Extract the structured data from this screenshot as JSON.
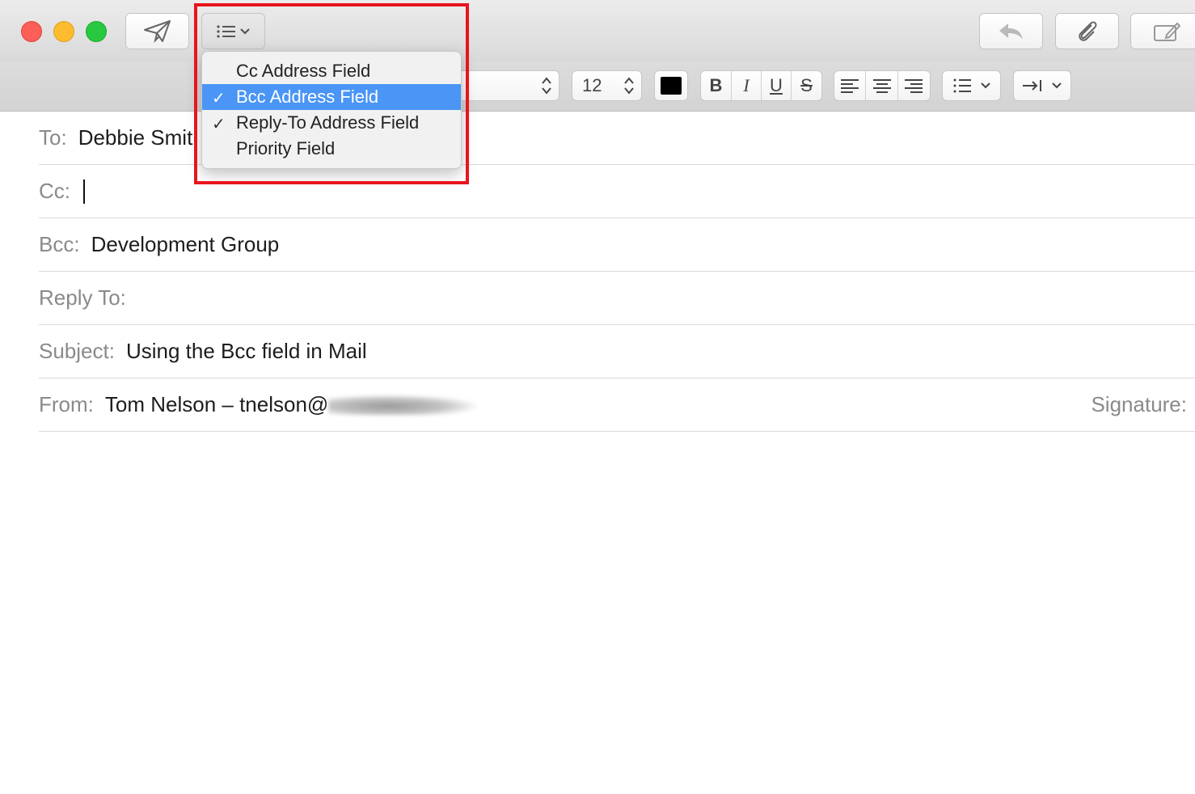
{
  "colors": {
    "accent": "#4a95f5",
    "annotation_border": "#e8141c",
    "text_color_swatch": "#000000"
  },
  "toolbar": {
    "send_icon": "paper-plane-icon",
    "header_fields_icon": "list-icon",
    "reply_icon": "reply-arrow-icon",
    "attach_icon": "paperclip-icon",
    "markup_icon": "compose-icon"
  },
  "format_bar": {
    "font_size": "12",
    "bold": "B",
    "italic": "I",
    "underline": "U",
    "strikethrough": "S"
  },
  "header_menu": {
    "items": [
      {
        "label": "Cc Address Field",
        "checked": false,
        "selected": false
      },
      {
        "label": "Bcc Address Field",
        "checked": true,
        "selected": true
      },
      {
        "label": "Reply-To Address Field",
        "checked": true,
        "selected": false
      },
      {
        "label": "Priority Field",
        "checked": false,
        "selected": false
      }
    ]
  },
  "fields": {
    "to_label": "To:",
    "to_value": "Debbie Smit",
    "cc_label": "Cc:",
    "bcc_label": "Bcc:",
    "bcc_value": "Development Group",
    "reply_to_label": "Reply To:",
    "subject_label": "Subject:",
    "subject_value": "Using the Bcc field in Mail",
    "from_label": "From:",
    "from_value": "Tom Nelson – tnelson@",
    "signature_label": "Signature:"
  }
}
